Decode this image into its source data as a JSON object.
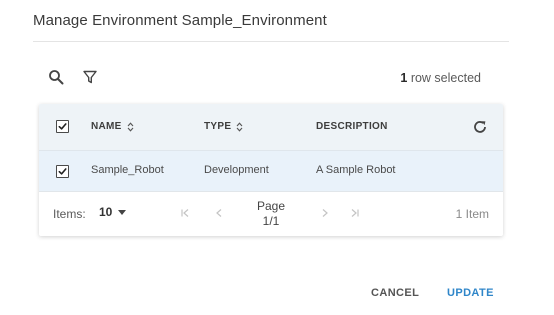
{
  "dialog": {
    "title": "Manage Environment Sample_Environment"
  },
  "toolbar": {
    "search_icon": "search-icon",
    "filter_icon": "filter-icon",
    "selected_count": "1",
    "selected_suffix": " row selected"
  },
  "grid": {
    "columns": [
      {
        "label": "NAME",
        "sortable": true
      },
      {
        "label": "TYPE",
        "sortable": true
      },
      {
        "label": "DESCRIPTION",
        "sortable": false
      }
    ],
    "header_checked": true,
    "rows": [
      {
        "checked": true,
        "name": "Sample_Robot",
        "type": "Development",
        "description": "A Sample Robot"
      }
    ],
    "refresh_icon": "refresh-icon"
  },
  "pager": {
    "items_label": "Items:",
    "page_size": "10",
    "page_label": "Page",
    "page_value": "1/1",
    "item_count": "1 Item"
  },
  "actions": {
    "cancel_label": "CANCEL",
    "update_label": "UPDATE"
  },
  "colors": {
    "accent": "#2f86c9",
    "header_bg": "#eef3f7",
    "selected_row_bg": "#e9f2fa"
  }
}
